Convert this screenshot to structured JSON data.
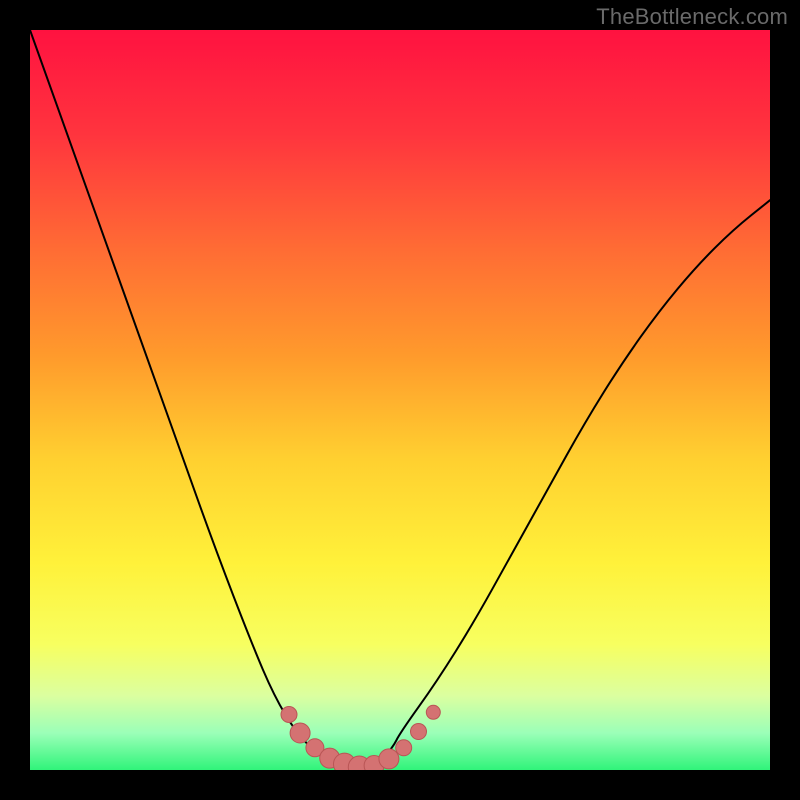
{
  "watermark": "TheBottleneck.com",
  "colors": {
    "curve": "#000000",
    "point_fill": "#d47272",
    "point_stroke": "#b95555",
    "gradient_stops": [
      {
        "offset": "0%",
        "color": "#ff1240"
      },
      {
        "offset": "14%",
        "color": "#ff343e"
      },
      {
        "offset": "30%",
        "color": "#ff6d34"
      },
      {
        "offset": "44%",
        "color": "#ff9a2c"
      },
      {
        "offset": "58%",
        "color": "#ffd030"
      },
      {
        "offset": "72%",
        "color": "#fff13a"
      },
      {
        "offset": "83%",
        "color": "#f7ff60"
      },
      {
        "offset": "90%",
        "color": "#dbffa0"
      },
      {
        "offset": "95%",
        "color": "#9bffb8"
      },
      {
        "offset": "100%",
        "color": "#30f47a"
      }
    ]
  },
  "chart_data": {
    "type": "line",
    "title": "",
    "xlabel": "",
    "ylabel": "",
    "x": [
      0.0,
      0.05,
      0.1,
      0.15,
      0.2,
      0.25,
      0.3,
      0.33,
      0.36,
      0.39,
      0.41,
      0.43,
      0.45,
      0.47,
      0.49,
      0.5,
      0.55,
      0.6,
      0.65,
      0.7,
      0.75,
      0.8,
      0.85,
      0.9,
      0.95,
      1.0
    ],
    "values": [
      1.0,
      0.86,
      0.72,
      0.58,
      0.44,
      0.3,
      0.17,
      0.1,
      0.05,
      0.02,
      0.01,
      0.0,
      0.0,
      0.01,
      0.03,
      0.05,
      0.12,
      0.2,
      0.29,
      0.38,
      0.47,
      0.55,
      0.62,
      0.68,
      0.73,
      0.77
    ],
    "xlim": [
      0,
      1
    ],
    "ylim": [
      0,
      1
    ],
    "note": "x/y are normalized to plot area; values represent relative bottleneck magnitude with minimum near x≈0.44",
    "highlight_points": [
      {
        "x": 0.35,
        "y": 0.075,
        "r": 8
      },
      {
        "x": 0.365,
        "y": 0.05,
        "r": 10
      },
      {
        "x": 0.385,
        "y": 0.03,
        "r": 9
      },
      {
        "x": 0.405,
        "y": 0.016,
        "r": 10
      },
      {
        "x": 0.425,
        "y": 0.008,
        "r": 11
      },
      {
        "x": 0.445,
        "y": 0.004,
        "r": 11
      },
      {
        "x": 0.465,
        "y": 0.006,
        "r": 10
      },
      {
        "x": 0.485,
        "y": 0.015,
        "r": 10
      },
      {
        "x": 0.505,
        "y": 0.03,
        "r": 8
      },
      {
        "x": 0.525,
        "y": 0.052,
        "r": 8
      },
      {
        "x": 0.545,
        "y": 0.078,
        "r": 7
      }
    ]
  }
}
